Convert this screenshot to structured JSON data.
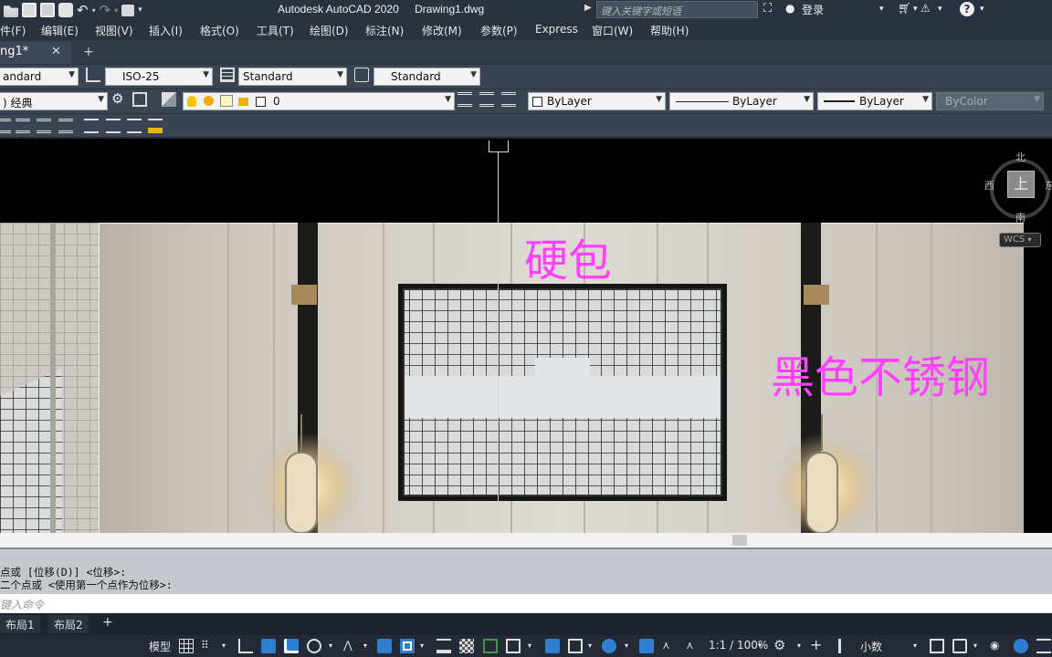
{
  "titlebar": {
    "app_title": "Autodesk AutoCAD 2020",
    "file_name": "Drawing1.dwg",
    "search_placeholder": "键入关键字或短语",
    "login_label": "登录"
  },
  "menubar": {
    "items": [
      "件(F)",
      "编辑(E)",
      "视图(V)",
      "插入(I)",
      "格式(O)",
      "工具(T)",
      "绘图(D)",
      "标注(N)",
      "修改(M)",
      "参数(P)",
      "Express",
      "窗口(W)",
      "帮助(H)"
    ]
  },
  "tabs": {
    "doc_tab": "ng1*"
  },
  "toolbar1": {
    "text_style": "andard",
    "dim_style": "ISO-25",
    "table_style": "Standard",
    "mleader_style": "Standard"
  },
  "toolbar2": {
    "workspace": ") 经典",
    "layer": "0",
    "color": "ByLayer",
    "linetype": "ByLayer",
    "lineweight": "ByLayer",
    "plotstyle": "ByColor"
  },
  "canvas": {
    "annotation_1": "硬包",
    "annotation_2": "黑色不锈钢",
    "viewcube_top": "上",
    "compass_n": "北",
    "compass_s": "南",
    "compass_w": "西",
    "compass_e": "东",
    "wcs_label": "WCS"
  },
  "command": {
    "history": [
      "点或 [位移(D)] <位移>:",
      "二个点或 <使用第一个点作为位移>:"
    ],
    "prompt_placeholder": "键入命令"
  },
  "layout_tabs": [
    "布局1",
    "布局2"
  ],
  "statusbar": {
    "model_label": "模型",
    "scale_label": "1:1 / 100%",
    "units_label": "小数"
  },
  "colors": {
    "annotation": "#ff40ff",
    "titlebar_bg": "#2a3240",
    "status_active": "#2f7fd1"
  }
}
